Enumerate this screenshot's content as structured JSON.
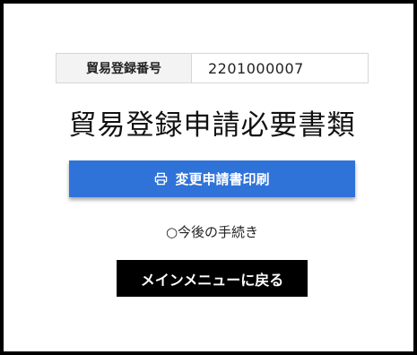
{
  "registration": {
    "label": "貿易登録番号",
    "value": "2201000007"
  },
  "title": "貿易登録申請必要書類",
  "print_button": {
    "icon": "printer-icon",
    "label": "変更申請書印刷",
    "color": "#2f73d9"
  },
  "next_steps": {
    "label": "○今後の手続き"
  },
  "menu_button": {
    "label": "メインメニューに戻る",
    "color": "#000000"
  }
}
